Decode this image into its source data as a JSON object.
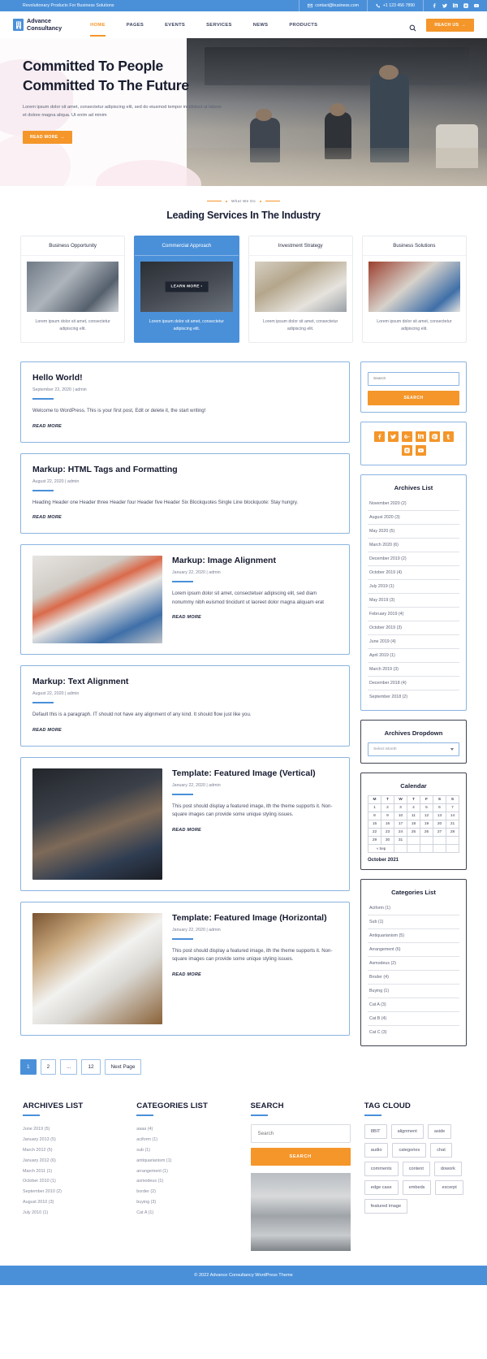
{
  "topbar": {
    "tagline": "Revolutionary Products For Business Solutions",
    "email": "contact@business.com",
    "phone": "+1 123 456 7890",
    "socials": [
      "facebook-icon",
      "twitter-icon",
      "linkedin-icon",
      "instagram-icon",
      "youtube-icon"
    ]
  },
  "nav": {
    "brand_line1": "Advance",
    "brand_line2": "Consultancy",
    "items": [
      {
        "label": "HOME",
        "active": true
      },
      {
        "label": "PAGES",
        "active": false
      },
      {
        "label": "EVENTS",
        "active": false
      },
      {
        "label": "SERVICES",
        "active": false
      },
      {
        "label": "NEWS",
        "active": false
      },
      {
        "label": "PRODUCTS",
        "active": false
      }
    ],
    "search_icon": "search-icon",
    "cta_label": "REACH US"
  },
  "hero": {
    "title_line1": "Committed To People",
    "title_line2": "Committed To The Future",
    "subtitle": "Lorem ipsum dolor sit amet, consectetur adipiscing elit, sed do eiusmod tempor incididunt ut labore et dolore magna aliqua. Ut enim ad minim",
    "cta_label": "READ MORE"
  },
  "services": {
    "eyebrow": "What We Do",
    "title": "Leading Services In The Industry",
    "cards": [
      {
        "title": "Business Opportunity",
        "text": "Lorem ipsum dolor sit amet, consectetur adipiscing elit.",
        "featured": false
      },
      {
        "title": "Commercial Approach",
        "text": "Lorem ipsum dolor sit amet, consectetur adipiscing elit.",
        "featured": true,
        "button": "LEARN MORE"
      },
      {
        "title": "Investment Strategy",
        "text": "Lorem ipsum dolor sit amet, consectetur adipiscing elit.",
        "featured": false
      },
      {
        "title": "Business Solutions",
        "text": "Lorem ipsum dolor sit amet, consectetur adipiscing elit.",
        "featured": false
      }
    ]
  },
  "posts": [
    {
      "title": "Hello World!",
      "meta": "September 22, 2020 | admin",
      "body": "Welcome to WordPress. This is your first post, Edit or delete it, the start writing!",
      "read_more": "READ MORE"
    },
    {
      "title": "Markup: HTML Tags and Formatting",
      "meta": "August 22, 2020 | admin",
      "body": "Heading Header one Header three Header four Header five Header Six Blockquotes Single Line blockquote: Stay hungry.",
      "read_more": "READ MORE"
    },
    {
      "title": "Markup: Image Alignment",
      "meta": "January 22, 2020 | admin",
      "body": "Lorem ipsum dolor sit amet, consectetuer adipiscing elit, sed diam nonummy nibh euismod tincidunt ut laoreet dolor magna aliquam erat",
      "read_more": "READ MORE"
    },
    {
      "title": "Markup: Text Alignment",
      "meta": "August 22, 2020 | admin",
      "body": "Default this is a paragraph. IT should not have any alignment of any kind. It should flow just like you.",
      "read_more": "READ MORE"
    },
    {
      "title": "Template: Featured Image (Vertical)",
      "meta": "January 22, 2020 | admin",
      "body": "This post should display a featured image, ith the theme supports it. Non-square images can provide some unique styling issues.",
      "read_more": "READ MORE"
    },
    {
      "title": "Template: Featured Image (Horizontal)",
      "meta": "January 22, 2020 | admin",
      "body": "This post should display a featured image, ith the theme supports it. Non-square images can provide some unique styling issues.",
      "read_more": "READ MORE"
    }
  ],
  "sidebar": {
    "search": {
      "placeholder": "Search",
      "button": "SEARCH"
    },
    "socials": [
      "facebook-icon",
      "twitter-icon",
      "googleplus-icon",
      "linkedin-icon",
      "pinterest-icon",
      "tumblr-icon",
      "instagram-icon",
      "youtube-icon"
    ],
    "archives": {
      "title": "Archives List",
      "items": [
        "November 2020 (2)",
        "August 2020 (3)",
        "May 2020 (5)",
        "March 2020 (6)",
        "December 2019 (2)",
        "October 2019 (4)",
        "July 2019 (1)",
        "May 2019 (3)",
        "February 2019 (4)",
        "October 2019 (3)",
        "June 2019 (4)",
        "April 2019 (1)",
        "March 2019 (3)",
        "December 2018 (4)",
        "September 2018 (2)"
      ]
    },
    "archives_dropdown": {
      "title": "Archives Dropdown",
      "selected": "Select Month"
    },
    "calendar": {
      "title": "Calendar",
      "weekdays": [
        "M",
        "T",
        "W",
        "T",
        "F",
        "S",
        "S"
      ],
      "weeks": [
        [
          "1",
          "2",
          "3",
          "4",
          "5",
          "6",
          "7"
        ],
        [
          "8",
          "9",
          "10",
          "11",
          "12",
          "13",
          "14"
        ],
        [
          "15",
          "16",
          "17",
          "18",
          "19",
          "20",
          "21"
        ],
        [
          "22",
          "23",
          "24",
          "25",
          "26",
          "27",
          "28"
        ],
        [
          "29",
          "30",
          "31",
          "",
          "",
          "",
          ""
        ]
      ],
      "prev_label": "« Sep",
      "caption": "October 2021"
    },
    "categories": {
      "title": "Categories List",
      "items": [
        "Aciform (1)",
        "Sub (1)",
        "Antiquarianism (5)",
        "Arrangement (6)",
        "Asmodeus (2)",
        "Broder (4)",
        "Buying (1)",
        "Cat A (3)",
        "Cat B (4)",
        "Cat C (3)"
      ]
    }
  },
  "pagination": {
    "pages": [
      "1",
      "2",
      "...",
      "12",
      "Next Page"
    ],
    "active": "1"
  },
  "footer": {
    "archives": {
      "title": "ARCHIVES LIST",
      "items": [
        "June 2019 (5)",
        "January  2013 (5)",
        "March 2012 (5)",
        "January  2012 (6)",
        "March  2011 (1)",
        "October 2010 (1)",
        "September 2010 (2)",
        "August 2010 (3)",
        "July 2010 (1)"
      ]
    },
    "categories": {
      "title": "CATEGORIES LIST",
      "items": [
        "aaaa (4)",
        "aciform (1)",
        "sub (1)",
        "antiquarianism (1)",
        "arrangement (1)",
        "asmodeus (1)",
        "border (2)",
        "buying (3)",
        "Cat A (1)"
      ]
    },
    "search": {
      "title": "SEARCH",
      "placeholder": "Search",
      "button": "SEARCH"
    },
    "tagcloud": {
      "title": "TAG CLOUD",
      "tags": [
        "8BIT",
        "alignment",
        "aside",
        "audio",
        "categories",
        "chat",
        "comments",
        "content",
        "dowork",
        "edge case",
        "embeds",
        "excerpt",
        "featured image"
      ]
    }
  },
  "footbar": {
    "copyright": "© 2022 Advance Consultancy WordPress Theme"
  }
}
